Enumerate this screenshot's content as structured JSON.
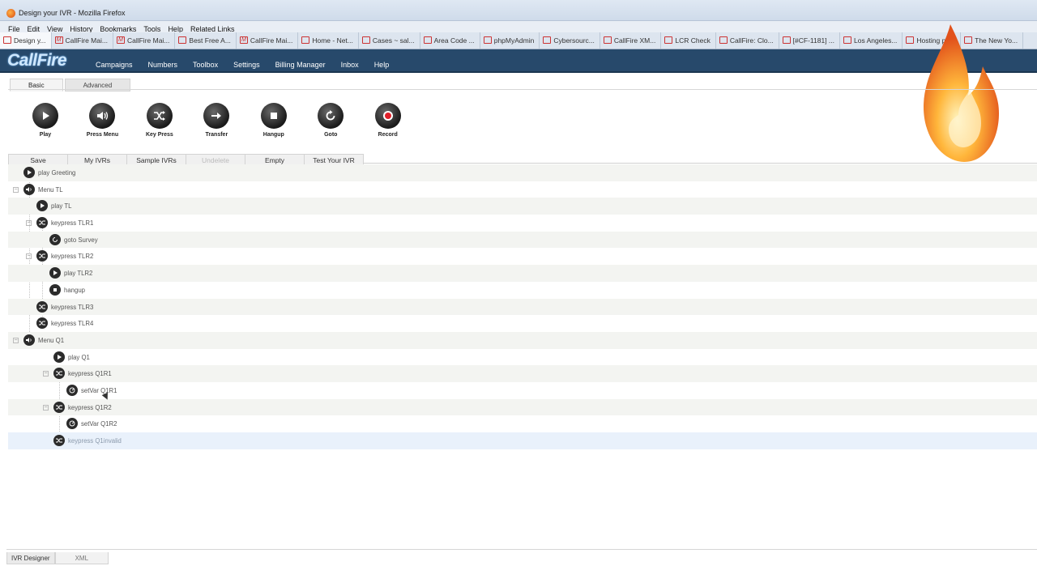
{
  "window": {
    "title": "Design your IVR - Mozilla Firefox"
  },
  "menubar": [
    "File",
    "Edit",
    "View",
    "History",
    "Bookmarks",
    "Tools",
    "Help",
    "Related Links"
  ],
  "browser_tabs": [
    {
      "label": "Design y...",
      "active": true
    },
    {
      "label": "CallFire Mai..."
    },
    {
      "label": "CallFire Mai..."
    },
    {
      "label": "Best Free A..."
    },
    {
      "label": "CallFire Mai..."
    },
    {
      "label": "Home - Net..."
    },
    {
      "label": "Cases ~ sal..."
    },
    {
      "label": "Area Code ..."
    },
    {
      "label": "phpMyAdmin"
    },
    {
      "label": "Cybersourc..."
    },
    {
      "label": "CallFire XM..."
    },
    {
      "label": "LCR Check"
    },
    {
      "label": "CallFire: Clo..."
    },
    {
      "label": "[#CF-1181] ..."
    },
    {
      "label": "Los Angeles..."
    },
    {
      "label": "Hosting pri..."
    },
    {
      "label": "The New Yo..."
    }
  ],
  "app": {
    "logo": "CallFire",
    "nav": [
      "Campaigns",
      "Numbers",
      "Toolbox",
      "Settings",
      "Billing Manager",
      "Inbox",
      "Help"
    ]
  },
  "designer_tabs": [
    "Basic",
    "Advanced"
  ],
  "tools": [
    {
      "label": "Play",
      "icon": "play-icon"
    },
    {
      "label": "Press Menu",
      "icon": "speaker-icon"
    },
    {
      "label": "Key Press",
      "icon": "shuffle-icon"
    },
    {
      "label": "Transfer",
      "icon": "arrow-right-icon"
    },
    {
      "label": "Hangup",
      "icon": "stop-icon"
    },
    {
      "label": "Goto",
      "icon": "refresh-icon"
    },
    {
      "label": "Record",
      "icon": "record-icon"
    }
  ],
  "actions": [
    {
      "label": "Save"
    },
    {
      "label": "My IVRs"
    },
    {
      "label": "Sample IVRs"
    },
    {
      "label": "Undelete",
      "disabled": true
    },
    {
      "label": "Empty"
    },
    {
      "label": "Test Your IVR"
    }
  ],
  "tree": [
    {
      "label": "play Greeting",
      "icon": "play",
      "level": 1,
      "toggle": false
    },
    {
      "label": "Menu TL",
      "icon": "speaker",
      "level": 1,
      "toggle": true
    },
    {
      "label": "play TL",
      "icon": "play",
      "level": 2,
      "toggle": false
    },
    {
      "label": "keypress TLR1",
      "icon": "shuffle",
      "level": 2,
      "toggle": true
    },
    {
      "label": "goto Survey",
      "icon": "refresh",
      "level": 3,
      "toggle": false
    },
    {
      "label": "keypress TLR2",
      "icon": "shuffle",
      "level": 2,
      "toggle": true
    },
    {
      "label": "play TLR2",
      "icon": "play",
      "level": 3,
      "toggle": false
    },
    {
      "label": "hangup",
      "icon": "stop",
      "level": 3,
      "toggle": false
    },
    {
      "label": "keypress TLR3",
      "icon": "shuffle",
      "level": 2,
      "toggle": false
    },
    {
      "label": "keypress TLR4",
      "icon": "shuffle",
      "level": 2,
      "toggle": false
    },
    {
      "label": "Menu Q1",
      "icon": "speaker",
      "level": 1,
      "toggle": true
    },
    {
      "label": "play Q1",
      "icon": "play",
      "level": 3,
      "toggle": false
    },
    {
      "label": "keypress Q1R1",
      "icon": "shuffle",
      "level": 3,
      "toggle": true
    },
    {
      "label": "setVar Q1R1",
      "icon": "gauge",
      "level": 4,
      "toggle": false
    },
    {
      "label": "keypress Q1R2",
      "icon": "shuffle",
      "level": 3,
      "toggle": true
    },
    {
      "label": "setVar Q1R2",
      "icon": "gauge",
      "level": 4,
      "toggle": false
    },
    {
      "label": "keypress Q1invalid",
      "icon": "shuffle",
      "level": 3,
      "toggle": false,
      "selected": true
    }
  ],
  "bottom_tabs": [
    "IVR Designer",
    "XML"
  ],
  "colors": {
    "appbar": "#27496b",
    "accent": "#cfe8ff",
    "selected_row": "#e9f1fb"
  }
}
